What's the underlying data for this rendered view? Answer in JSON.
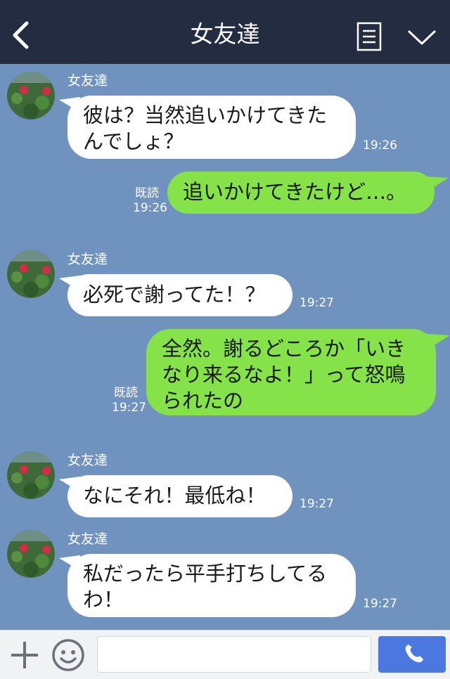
{
  "header": {
    "title": "女友達",
    "back_icon": "chevron-left-icon",
    "menu_icon": "menu-list-icon",
    "collapse_icon": "chevron-down-icon"
  },
  "messages": [
    {
      "sender": "女友達",
      "text": "彼は？当然追いかけてきたんでしょ？",
      "time": "19:26"
    },
    {
      "text": "追いかけてきたけど…。",
      "read": "既読",
      "time": "19:26"
    },
    {
      "sender": "女友達",
      "text": "必死で謝ってた！？",
      "time": "19:27"
    },
    {
      "text": "全然。謝るどころか「いきなり来るなよ！」って怒鳴られたの",
      "read": "既読",
      "time": "19:27"
    },
    {
      "sender": "女友達",
      "text": "なにそれ！最低ね！",
      "time": "19:27"
    },
    {
      "sender": "女友達",
      "text": "私だったら平手打ちしてるわ！",
      "time": "19:27"
    }
  ],
  "input_bar": {
    "plus_icon": "plus-icon",
    "emoji_icon": "smiley-icon",
    "input_value": "",
    "call_icon": "phone-icon"
  },
  "colors": {
    "header_bg": "#242c42",
    "chat_bg": "#7092be",
    "incoming_bubble": "#ffffff",
    "outgoing_bubble": "#85e249",
    "call_button": "#4b78e0"
  }
}
